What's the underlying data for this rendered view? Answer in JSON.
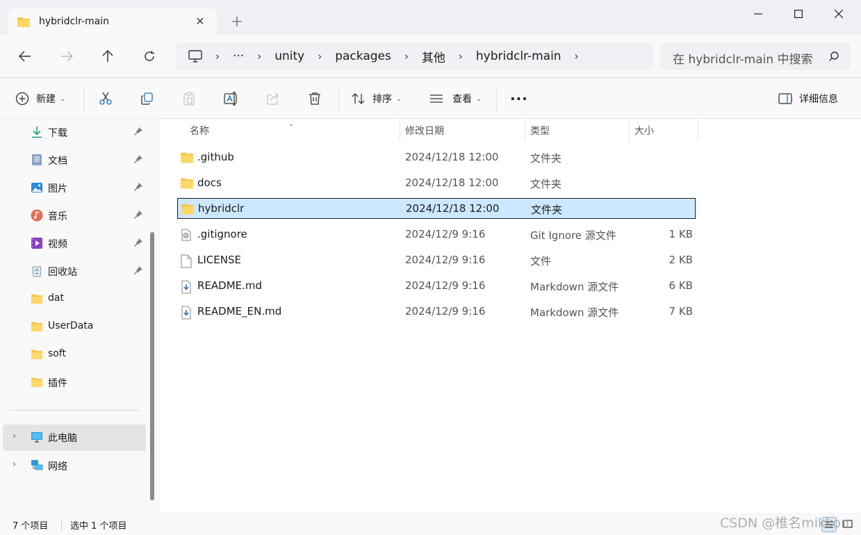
{
  "window": {
    "tab_title": "hybridclr-main",
    "new_tab": "+",
    "close_tab": "✕"
  },
  "nav": {
    "breadcrumbs": [
      "unity",
      "packages",
      "其他",
      "hybridclr-main"
    ],
    "ellipsis": "···",
    "search_placeholder": "在 hybridclr-main 中搜索"
  },
  "toolbar": {
    "new_label": "新建",
    "sort_label": "排序",
    "view_label": "查看",
    "more": "···",
    "details_label": "详细信息"
  },
  "sidebar": {
    "quick_access": [
      {
        "label": "下载",
        "icon": "download-icon"
      },
      {
        "label": "文档",
        "icon": "document-icon"
      },
      {
        "label": "图片",
        "icon": "pictures-icon"
      },
      {
        "label": "音乐",
        "icon": "music-icon"
      },
      {
        "label": "视频",
        "icon": "video-icon"
      },
      {
        "label": "回收站",
        "icon": "recycle-bin-icon"
      },
      {
        "label": "dat",
        "icon": "folder-icon"
      },
      {
        "label": "UserData",
        "icon": "folder-icon"
      },
      {
        "label": "soft",
        "icon": "folder-icon"
      },
      {
        "label": "插件",
        "icon": "folder-icon"
      }
    ],
    "this_pc": "此电脑",
    "network": "网络"
  },
  "columns": {
    "name": "名称",
    "modified": "修改日期",
    "type": "类型",
    "size": "大小"
  },
  "files": [
    {
      "name": ".github",
      "modified": "2024/12/18 12:00",
      "type": "文件夹",
      "size": "",
      "icon": "folder-icon"
    },
    {
      "name": "docs",
      "modified": "2024/12/18 12:00",
      "type": "文件夹",
      "size": "",
      "icon": "folder-icon"
    },
    {
      "name": "hybridclr",
      "modified": "2024/12/18 12:00",
      "type": "文件夹",
      "size": "",
      "icon": "folder-icon",
      "selected": true
    },
    {
      "name": ".gitignore",
      "modified": "2024/12/9 9:16",
      "type": "Git Ignore 源文件",
      "size": "1 KB",
      "icon": "gear-file-icon"
    },
    {
      "name": "LICENSE",
      "modified": "2024/12/9 9:16",
      "type": "文件",
      "size": "2 KB",
      "icon": "file-icon"
    },
    {
      "name": "README.md",
      "modified": "2024/12/9 9:16",
      "type": "Markdown 源文件",
      "size": "6 KB",
      "icon": "markdown-file-icon"
    },
    {
      "name": "README_EN.md",
      "modified": "2024/12/9 9:16",
      "type": "Markdown 源文件",
      "size": "7 KB",
      "icon": "markdown-file-icon"
    }
  ],
  "status": {
    "item_count": "7 个项目",
    "selected_count": "选中 1 个项目"
  },
  "watermark": "CSDN @椎名mikkon",
  "colors": {
    "selection": "#cce8ff",
    "folder": "#f8c84a",
    "accent": "#0067c0"
  }
}
